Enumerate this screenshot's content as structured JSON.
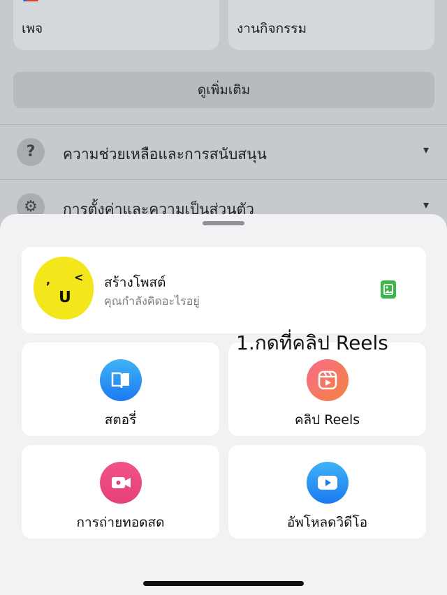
{
  "background": {
    "cards": [
      {
        "label": "เพจ",
        "icon": "flag-icon"
      },
      {
        "label": "งานกิจกรรม",
        "icon": "star-icon"
      }
    ],
    "see_more_label": "ดูเพิ่มเติม",
    "rows": [
      {
        "label": "ความช่วยเหลือและการสนับสนุน",
        "icon": "help-icon",
        "icon_glyph": "?"
      },
      {
        "label": "การตั้งค่าและความเป็นส่วนตัว",
        "icon": "gear-icon",
        "icon_glyph": "⚙"
      }
    ],
    "chevron_glyph": "⌄"
  },
  "sheet": {
    "create_post": {
      "title": "สร้างโพสต์",
      "subtitle": "คุณกำลังคิดอะไรอยู่",
      "avatar_color": "#f3e61a",
      "photo_icon": "photo-icon"
    },
    "tiles": [
      {
        "label": "สตอรี่",
        "icon": "book-icon",
        "color_top": "#3fb2f7",
        "color_bottom": "#1c7af0"
      },
      {
        "label": "คลิป Reels",
        "icon": "reels-icon",
        "color_top": "#f96a8a",
        "color_bottom": "#f3843f"
      },
      {
        "label": "การถ่ายทอดสด",
        "icon": "video-camera-icon",
        "color_top": "#f2528a",
        "color_bottom": "#e5407a"
      },
      {
        "label": "อัพโหลดวิดีโอ",
        "icon": "play-icon",
        "color_top": "#3fb2f7",
        "color_bottom": "#1c7af0"
      }
    ]
  },
  "annotation": "1.กดที่คลิป Reels"
}
